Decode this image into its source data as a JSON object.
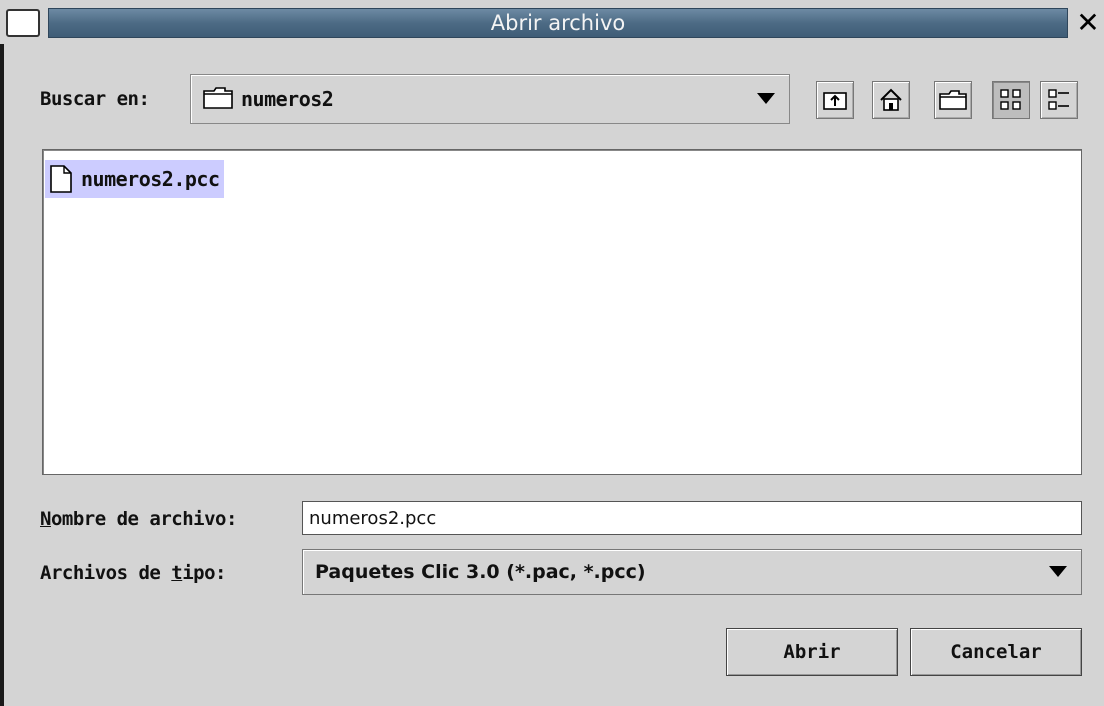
{
  "window": {
    "title": "Abrir archivo",
    "close_glyph": "✕"
  },
  "lookin": {
    "label": "Buscar en:",
    "current": "numeros2",
    "folder_icon": "folder-icon"
  },
  "toolbar": {
    "buttons": [
      {
        "name": "up-folder-button",
        "icon": "up-folder-icon"
      },
      {
        "name": "home-button",
        "icon": "home-icon"
      },
      {
        "name": "new-folder-button",
        "icon": "new-folder-icon"
      },
      {
        "name": "list-view-button",
        "icon": "list-view-icon",
        "pressed": true
      },
      {
        "name": "details-view-button",
        "icon": "details-view-icon"
      }
    ]
  },
  "files": [
    {
      "name": "numeros2.pcc",
      "selected": true,
      "icon": "file-icon"
    }
  ],
  "filename": {
    "label_mnemonic": "N",
    "label_rest": "ombre de archivo:",
    "value": "numeros2.pcc"
  },
  "filetype": {
    "label_prefix": "Archivos de ",
    "label_mnemonic": "t",
    "label_suffix": "ipo:",
    "value": "Paquetes Clic 3.0 (*.pac, *.pcc)"
  },
  "buttons": {
    "open": "Abrir",
    "cancel": "Cancelar"
  },
  "colors": {
    "titlebar": "#4f6e88",
    "selection": "#ccccff"
  }
}
